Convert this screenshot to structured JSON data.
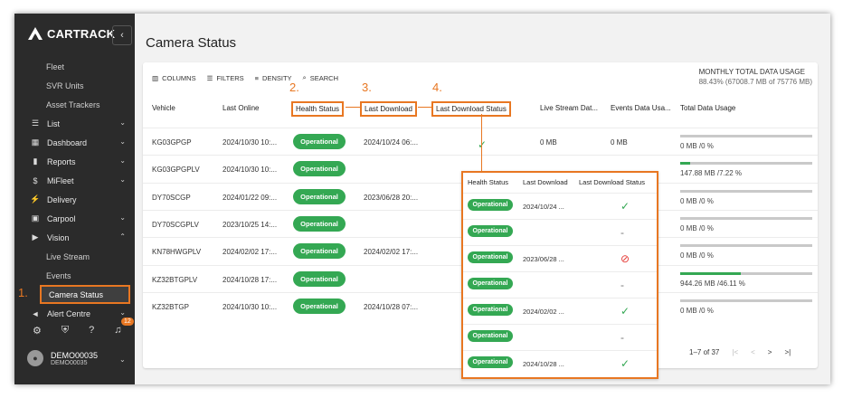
{
  "app": {
    "logo_text": "CARTRACK",
    "collapse_glyph": "‹",
    "accent_color": "#e87722",
    "sidebar_bg": "#2b2b2b",
    "status_green": "#34a853"
  },
  "sidebar": {
    "sub_top": [
      "Fleet",
      "SVR Units",
      "Asset Trackers"
    ],
    "items": [
      {
        "label": "List",
        "icon": "list-icon",
        "glyph": "☰"
      },
      {
        "label": "Dashboard",
        "icon": "dashboard-icon",
        "glyph": "▦"
      },
      {
        "label": "Reports",
        "icon": "reports-icon",
        "glyph": "▮"
      },
      {
        "label": "MiFleet",
        "icon": "dollar-icon",
        "glyph": "$"
      },
      {
        "label": "Delivery",
        "icon": "bolt-icon",
        "glyph": "⚡"
      },
      {
        "label": "Carpool",
        "icon": "calendar-icon",
        "glyph": "▣"
      },
      {
        "label": "Vision",
        "icon": "video-icon",
        "glyph": "▶"
      }
    ],
    "vision_sub": [
      "Live Stream",
      "Events",
      "Camera Status"
    ],
    "alert": {
      "label": "Alert Centre",
      "glyph": "◄"
    },
    "notification_count": "12",
    "user": {
      "name": "DEMO00035",
      "sub": "DEMO00035",
      "initial": "●"
    }
  },
  "annotations": {
    "a1": "1.",
    "a2": "2.",
    "a3": "3.",
    "a4": "4."
  },
  "page": {
    "title": "Camera Status"
  },
  "toolbar": {
    "columns": "COLUMNS",
    "filters": "FILTERS",
    "density": "DENSITY",
    "search": "SEARCH"
  },
  "usage": {
    "title": "MONTHLY TOTAL DATA USAGE",
    "value": "88.43% (67008.7 MB of 75776 MB)"
  },
  "table": {
    "headers": {
      "vehicle": "Vehicle",
      "last_online": "Last Online",
      "health": "Health Status",
      "last_download": "Last Download",
      "last_download_status": "Last Download Status",
      "live_stream": "Live Stream Dat...",
      "events": "Events Data Usa...",
      "total": "Total Data Usage"
    },
    "rows": [
      {
        "vehicle": "KG03GPGP",
        "last_online": "2024/10/30 10:...",
        "health": "Operational",
        "last_download": "2024/10/24 06:...",
        "live": "0 MB",
        "events": "0 MB",
        "total": "0 MB /0 %",
        "usage_pct": 0
      },
      {
        "vehicle": "KG03GPGPLV",
        "last_online": "2024/10/30 10:...",
        "health": "Operational",
        "last_download": "",
        "live": "",
        "events": "",
        "total": "147.88 MB /7.22 %",
        "usage_pct": 7.22
      },
      {
        "vehicle": "DY70SCGP",
        "last_online": "2024/01/22 09:...",
        "health": "Operational",
        "last_download": "2023/06/28 20:...",
        "live": "",
        "events": "",
        "total": "0 MB /0 %",
        "usage_pct": 0
      },
      {
        "vehicle": "DY70SCGPLV",
        "last_online": "2023/10/25 14:...",
        "health": "Operational",
        "last_download": "",
        "live": "",
        "events": "",
        "total": "0 MB /0 %",
        "usage_pct": 0
      },
      {
        "vehicle": "KN78HWGPLV",
        "last_online": "2024/02/02 17:...",
        "health": "Operational",
        "last_download": "2024/02/02 17:...",
        "live": "",
        "events": "",
        "total": "0 MB /0 %",
        "usage_pct": 0
      },
      {
        "vehicle": "KZ32BTGPLV",
        "last_online": "2024/10/28 17:...",
        "health": "Operational",
        "last_download": "",
        "live": "",
        "events": "",
        "total": "944.26 MB /46.11 %",
        "usage_pct": 46.11
      },
      {
        "vehicle": "KZ32BTGP",
        "last_online": "2024/10/30 10:...",
        "health": "Operational",
        "last_download": "2024/10/28 07:...",
        "live": "",
        "events": "",
        "total": "0 MB /0 %",
        "usage_pct": 0
      }
    ]
  },
  "pagination": {
    "range": "1–7 of 37",
    "first": "|<",
    "prev": "<",
    "next": ">",
    "last": ">|"
  },
  "zoom": {
    "headers": {
      "health": "Health Status",
      "last_download": "Last Download",
      "status": "Last Download Status"
    },
    "rows": [
      {
        "health": "Operational",
        "last_download": "2024/10/24 ...",
        "status": "check"
      },
      {
        "health": "Operational",
        "last_download": "",
        "status": "dash"
      },
      {
        "health": "Operational",
        "last_download": "2023/06/28 ...",
        "status": "ban"
      },
      {
        "health": "Operational",
        "last_download": "",
        "status": "dash"
      },
      {
        "health": "Operational",
        "last_download": "2024/02/02 ...",
        "status": "check"
      },
      {
        "health": "Operational",
        "last_download": "",
        "status": "dash"
      },
      {
        "health": "Operational",
        "last_download": "2024/10/28 ...",
        "status": "check"
      }
    ],
    "glyphs": {
      "check": "✓",
      "dash": "-",
      "ban": "⊘"
    }
  },
  "first_row_status_glyph": "✓"
}
